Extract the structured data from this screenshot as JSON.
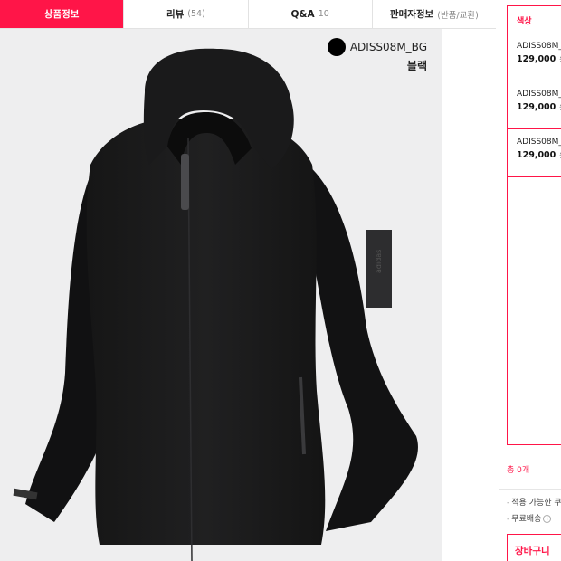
{
  "tabs": [
    {
      "label": "상품정보",
      "sub": ""
    },
    {
      "label": "리뷰",
      "sub": "(54)"
    },
    {
      "label": "Q&A",
      "sub": "10"
    },
    {
      "label": "판매자정보",
      "sub": "(반품/교환)"
    }
  ],
  "product": {
    "code": "ADISS08M_BG",
    "color_name": "블랙",
    "swatch_color": "#000000"
  },
  "side": {
    "header": "색상",
    "options": [
      {
        "code": "ADISS08M_",
        "price": "129,000",
        "unit": "원"
      },
      {
        "code": "ADISS08M_",
        "price": "129,000",
        "unit": "원"
      },
      {
        "code": "ADISS08M_",
        "price": "129,000",
        "unit": "원"
      }
    ],
    "total": "총 0개",
    "notes": [
      "적용 가능한 쿠",
      "무료배송"
    ],
    "cart_label": "장바구니"
  },
  "colors": {
    "accent": "#ff1548",
    "photo_bg": "#eeeeef"
  }
}
